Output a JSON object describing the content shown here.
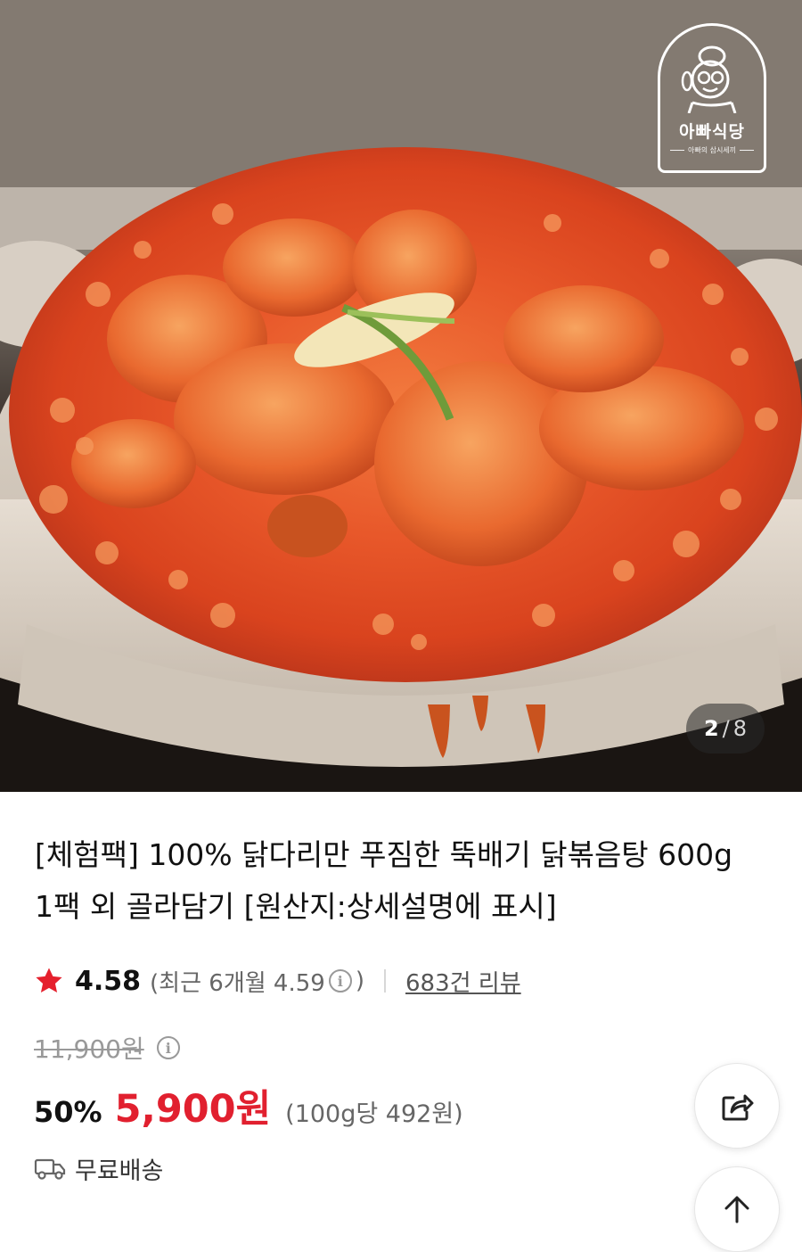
{
  "gallery": {
    "current_page": "2",
    "separator": "/",
    "total_pages": "8",
    "brand_logo": {
      "name": "아빠식당",
      "tagline": "아빠의 삼시세끼"
    }
  },
  "product": {
    "title": "[체험팩] 100% 닭다리만 푸짐한 뚝배기 닭볶음탕 600g 1팩 외 골라담기 [원산지:상세설명에 표시]",
    "rating": {
      "value": "4.58",
      "recent_label": "(최근 6개월 4.59",
      "recent_close": ")",
      "review_count": "683건 리뷰"
    },
    "price": {
      "original": "11,900원",
      "discount": "50%",
      "sale": "5,900원",
      "unit": "(100g당 492원)"
    },
    "shipping": {
      "label": "무료배송"
    }
  },
  "icons": {
    "rating_star": "star-icon",
    "info": "info-icon",
    "shipping": "truck-icon",
    "share": "share-icon",
    "scroll_top": "arrow-up-icon"
  },
  "colors": {
    "accent_red": "#e1202f",
    "star": "#e5202d",
    "muted_text": "#999999"
  }
}
